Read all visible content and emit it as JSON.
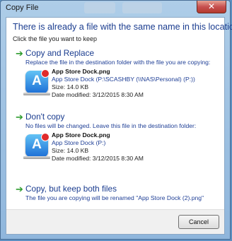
{
  "window": {
    "title": "Copy File",
    "close_glyph": "✕",
    "background_tabs": [
      "",
      ""
    ]
  },
  "dialog": {
    "heading": "There is already a file with the same name in this location.",
    "subheading": "Click the file you want to keep"
  },
  "options": [
    {
      "icon": "green-arrow-icon",
      "title": "Copy and Replace",
      "description": "Replace the file in the destination folder with the file you are copying:",
      "file": {
        "name": "App Store Dock.png",
        "location": "App Store Dock (P:\\SCASHBY (\\\\NAS\\Personal) (P:))",
        "size": "Size: 14.0 KB",
        "modified": "Date modified: 3/12/2015 8:30 AM"
      }
    },
    {
      "icon": "green-arrow-icon",
      "title": "Don't copy",
      "description": "No files will be changed. Leave this file in the destination folder:",
      "file": {
        "name": "App Store Dock.png",
        "location": "App Store Dock (P:)",
        "size": "Size: 14.0 KB",
        "modified": "Date modified: 3/12/2015 8:30 AM"
      }
    },
    {
      "icon": "green-arrow-icon",
      "title": "Copy, but keep both files",
      "description": "The file you are copying will be renamed \"App Store Dock (2).png\""
    }
  ],
  "footer": {
    "cancel_label": "Cancel"
  },
  "colors": {
    "heading_blue": "#1a3c8f",
    "arrow_green": "#2e9c2e",
    "close_red": "#c75050"
  }
}
